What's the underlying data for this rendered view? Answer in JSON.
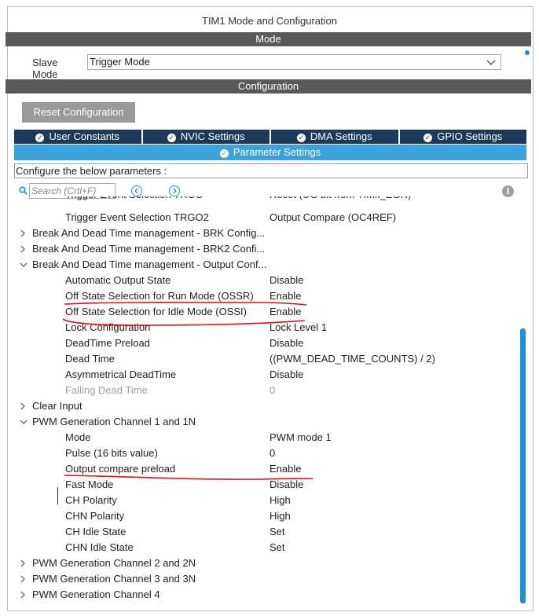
{
  "window": {
    "title": "TIM1 Mode and Configuration"
  },
  "mode_bar": {
    "label": "Mode"
  },
  "slave_mode": {
    "label": "Slave Mode",
    "value": "Trigger Mode"
  },
  "config_bar": {
    "label": "Configuration"
  },
  "reset_button": {
    "label": "Reset Configuration"
  },
  "tabs": [
    {
      "label": "User Constants"
    },
    {
      "label": "NVIC Settings"
    },
    {
      "label": "DMA Settings"
    },
    {
      "label": "GPIO Settings"
    }
  ],
  "active_tab": {
    "label": "Parameter Settings"
  },
  "configure_text": "Configure the below parameters :",
  "search": {
    "placeholder": "Search (Crtl+F)"
  },
  "tree": {
    "cut_row": {
      "name": "Trigger Event Selection TRGO",
      "value": "Reset (UG bit from TIMx_EGR)"
    },
    "trgo2": {
      "name": "Trigger Event Selection TRGO2",
      "value": "Output Compare (OC4REF)"
    },
    "groups": [
      {
        "label": "Break And Dead Time management - BRK Config...",
        "expanded": false
      },
      {
        "label": "Break And Dead Time management - BRK2 Confi...",
        "expanded": false
      },
      {
        "label": "Break And Dead Time management - Output Conf...",
        "expanded": true
      },
      {
        "label": "Clear Input",
        "expanded": false
      },
      {
        "label": "PWM Generation Channel 1 and 1N",
        "expanded": true
      },
      {
        "label": "PWM Generation Channel 2 and 2N",
        "expanded": false
      },
      {
        "label": "PWM Generation Channel 3 and 3N",
        "expanded": false
      },
      {
        "label": "PWM Generation Channel 4",
        "expanded": false
      }
    ],
    "output_params": [
      {
        "name": "Automatic Output State",
        "value": "Disable"
      },
      {
        "name": "Off State Selection for Run Mode (OSSR)",
        "value": "Enable"
      },
      {
        "name": "Off State Selection for Idle Mode (OSSI)",
        "value": "Enable"
      },
      {
        "name": "Lock Configuration",
        "value": "Lock Level 1"
      },
      {
        "name": "DeadTime Preload",
        "value": "Disable"
      },
      {
        "name": "Dead Time",
        "value": "((PWM_DEAD_TIME_COUNTS) / 2)"
      },
      {
        "name": "Asymmetrical DeadTime",
        "value": "Disable"
      },
      {
        "name": "Falling Dead Time",
        "value": "0"
      }
    ],
    "pwm1_params": [
      {
        "name": "Mode",
        "value": "PWM mode 1"
      },
      {
        "name": "Pulse (16 bits value)",
        "value": "0"
      },
      {
        "name": "Output compare preload",
        "value": "Enable"
      },
      {
        "name": "Fast Mode",
        "value": "Disable"
      },
      {
        "name": "CH Polarity",
        "value": "High"
      },
      {
        "name": "CHN Polarity",
        "value": "High"
      },
      {
        "name": "CH Idle State",
        "value": "Set"
      },
      {
        "name": "CHN Idle State",
        "value": "Set"
      }
    ]
  },
  "icons": {
    "check": "check-circle-icon",
    "search": "search-icon",
    "prev": "chevron-left-circle-icon",
    "next": "chevron-right-circle-icon",
    "info": "info-icon",
    "dropdown": "chevron-down-icon"
  },
  "colors": {
    "bar": "#595959",
    "tab": "#1b3a5a",
    "active_tab": "#3aa3dc",
    "annotation": "#e0101a"
  }
}
